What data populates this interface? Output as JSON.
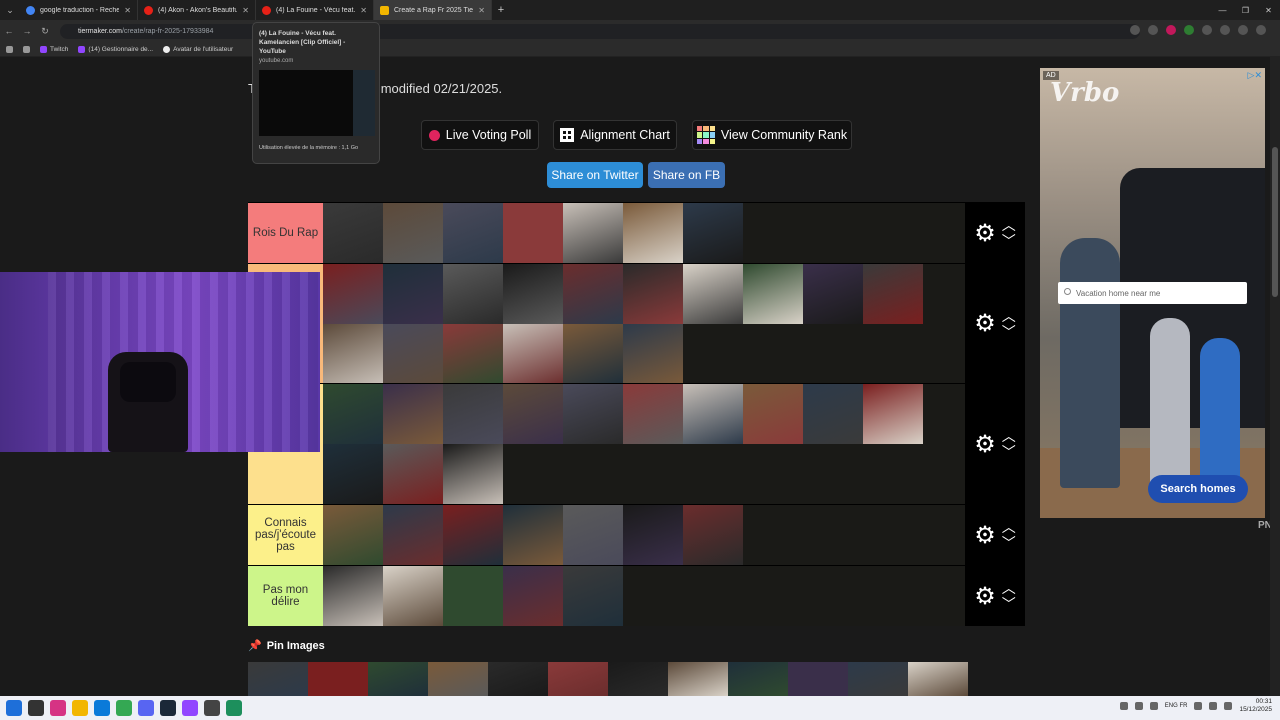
{
  "browser": {
    "tabs": [
      {
        "title": "google traduction - Recherche",
        "color": "#4285f4"
      },
      {
        "title": "(4) Akon - Akon's Beautiful Day",
        "color": "#e62117"
      },
      {
        "title": "(4) La Fouine - Vécu feat. Kame",
        "color": "#e62117"
      },
      {
        "title": "Create a Rap Fr 2025 Tier List -",
        "color": "#f2b600"
      }
    ],
    "new_tab_label": "+",
    "url_host": "tiermaker.com",
    "url_path": "/create/rap-fr-2025-17933984",
    "bookmarks": [
      "Twitch",
      "(14) Gestionnaire de...",
      "Avatar de l'utilisateur"
    ]
  },
  "preview": {
    "title": "(4) La Fouine - Vécu feat. Kamelancien [Clip Officiel] - YouTube",
    "domain": "youtube.com",
    "memory": "Utilisation élevée de la mémoire : 1,1 Go"
  },
  "page": {
    "modified_text": "T                                images and was last modified 02/21/2025.",
    "buttons": {
      "live_voting": "Live Voting Poll",
      "alignment": "Alignment Chart",
      "community": "View Community Rank",
      "twitter": "Share on Twitter",
      "fb": "Share on FB"
    },
    "tiers": [
      {
        "label": "Rois Du Rap",
        "color": "#f47c7c",
        "count": 7
      },
      {
        "label": "",
        "color": "#f9b97a",
        "count": 16
      },
      {
        "label": "",
        "color": "#fde08d",
        "count": 13
      },
      {
        "label": "Connais pas/j'écoute pas",
        "color": "#fcf08a",
        "count": 7
      },
      {
        "label": "Pas mon délire",
        "color": "#cdf58a",
        "count": 5
      }
    ],
    "pin_label": "Pin Images"
  },
  "ad": {
    "tag": "AD",
    "logo": "Vrbo",
    "search_placeholder": "Vacation home near me",
    "cta": "Search homes",
    "side_text": "PN"
  },
  "taskbar": {
    "lang": "ENG FR",
    "time": "00:31",
    "date": "15/12/2025"
  }
}
